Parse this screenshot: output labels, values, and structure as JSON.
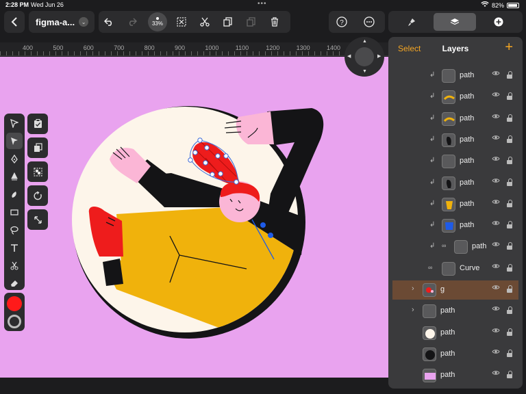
{
  "status": {
    "time": "2:28 PM",
    "date": "Wed Jun 26",
    "battery": "82%"
  },
  "toolbar": {
    "doc_title": "figma-a...",
    "zoom": "33%"
  },
  "ruler": {
    "labels": [
      "400",
      "500",
      "600",
      "700",
      "800",
      "900",
      "1000",
      "1100",
      "1200",
      "1300",
      "1400"
    ]
  },
  "panel": {
    "select": "Select",
    "title": "Layers",
    "add": "+",
    "layers": [
      {
        "name": "path",
        "indent": 2,
        "thumb": "empty",
        "arrow": true
      },
      {
        "name": "path",
        "indent": 2,
        "thumb": "yellow-stroke",
        "arrow": true
      },
      {
        "name": "path",
        "indent": 2,
        "thumb": "yellow-stroke",
        "arrow": true
      },
      {
        "name": "path",
        "indent": 2,
        "thumb": "black-shape",
        "arrow": true
      },
      {
        "name": "path",
        "indent": 2,
        "thumb": "empty",
        "arrow": true
      },
      {
        "name": "path",
        "indent": 2,
        "thumb": "black-shape",
        "arrow": true
      },
      {
        "name": "path",
        "indent": 2,
        "thumb": "yellow-fill",
        "arrow": true
      },
      {
        "name": "path",
        "indent": 2,
        "thumb": "blue-fill",
        "arrow": true
      },
      {
        "name": "path",
        "indent": 3,
        "thumb": "empty",
        "arrow": true,
        "chain": true
      },
      {
        "name": "Curve",
        "indent": 1,
        "thumb": "empty",
        "chain": true
      },
      {
        "name": "g",
        "indent": 0,
        "thumb": "g",
        "expander": true,
        "selected": true
      },
      {
        "name": "path",
        "indent": 0,
        "thumb": "empty",
        "expander": true
      },
      {
        "name": "path",
        "indent": 0,
        "thumb": "white-circle"
      },
      {
        "name": "path",
        "indent": 0,
        "thumb": "black-circle"
      },
      {
        "name": "path",
        "indent": 0,
        "thumb": "pink-rect"
      }
    ]
  },
  "colors": {
    "fill": "#ff1a1a",
    "canvas": "#e9a3ef",
    "accent": "#f5a623"
  }
}
